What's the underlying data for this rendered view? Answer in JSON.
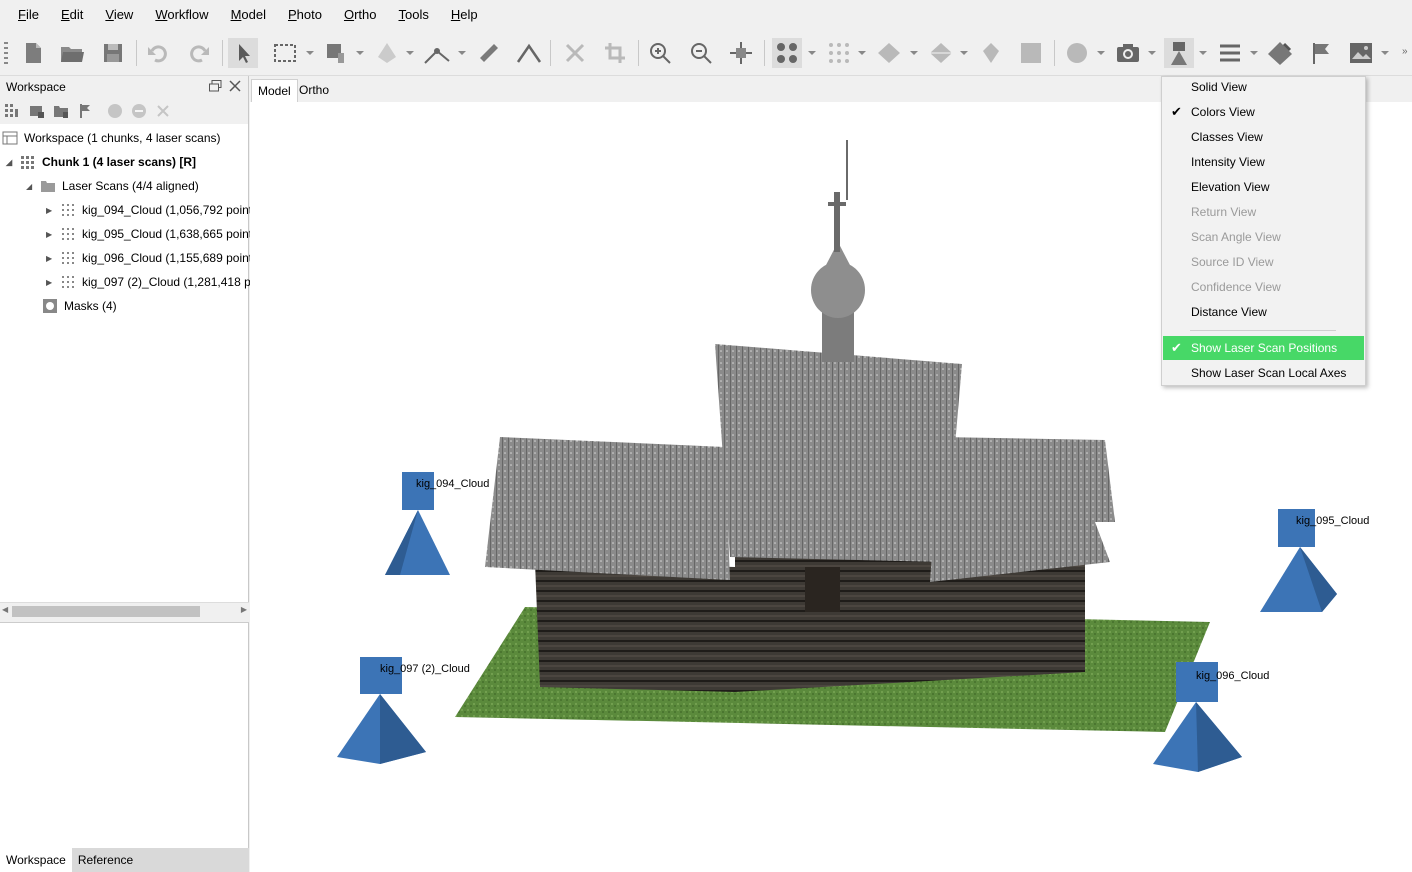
{
  "menubar": {
    "items": [
      {
        "underline": "F",
        "rest": "ile"
      },
      {
        "underline": "E",
        "rest": "dit"
      },
      {
        "underline": "V",
        "rest": "iew"
      },
      {
        "underline": "W",
        "rest": "orkflow"
      },
      {
        "underline": "M",
        "rest": "odel"
      },
      {
        "underline": "P",
        "rest": "hoto"
      },
      {
        "underline": "O",
        "rest": "rtho"
      },
      {
        "underline": "T",
        "rest": "ools"
      },
      {
        "underline": "H",
        "rest": "elp"
      }
    ]
  },
  "workspace_panel": {
    "title": "Workspace",
    "tree": {
      "root": "Workspace (1 chunks, 4 laser scans)",
      "chunk": "Chunk 1 (4 laser scans) [R]",
      "laser_scans_folder": "Laser Scans (4/4 aligned)",
      "scans": [
        "kig_094_Cloud (1,056,792 point",
        "kig_095_Cloud (1,638,665 point",
        "kig_096_Cloud (1,155,689 point",
        "kig_097 (2)_Cloud (1,281,418 pc"
      ],
      "masks": "Masks (4)"
    },
    "bottom_tabs": [
      "Workspace",
      "Reference"
    ]
  },
  "view_tabs": [
    "Model",
    "Ortho"
  ],
  "dropdown": {
    "items": [
      {
        "label": "Solid View",
        "state": "normal"
      },
      {
        "label": "Colors View",
        "state": "checked"
      },
      {
        "label": "Classes View",
        "state": "normal"
      },
      {
        "label": "Intensity View",
        "state": "normal"
      },
      {
        "label": "Elevation View",
        "state": "normal"
      },
      {
        "label": "Return View",
        "state": "disabled"
      },
      {
        "label": "Scan Angle View",
        "state": "disabled"
      },
      {
        "label": "Source ID View",
        "state": "disabled"
      },
      {
        "label": "Confidence View",
        "state": "disabled"
      },
      {
        "label": "Distance View",
        "state": "normal"
      },
      {
        "label": "Show Laser Scan Positions",
        "state": "highlighted-checked"
      },
      {
        "label": "Show Laser Scan Local Axes",
        "state": "normal"
      }
    ]
  },
  "viewport": {
    "scan_labels": [
      "kig_094_Cloud",
      "kig_095_Cloud",
      "kig_096_Cloud",
      "kig_097 (2)_Cloud"
    ],
    "scan_marker_color": "#3c74b6",
    "highlight_color": "#47d867"
  },
  "toolbar": {
    "icons": [
      "new-document-icon",
      "open-folder-icon",
      "save-icon",
      "undo-icon",
      "redo-icon",
      "select-arrow-icon",
      "rectangle-select-icon",
      "brush-select-icon",
      "shape-icon",
      "marker-icon",
      "ruler-icon",
      "measure-icon",
      "delete-icon",
      "crop-icon",
      "zoom-in-icon",
      "zoom-out-icon",
      "move-icon",
      "points-view-icon",
      "dense-points-icon",
      "mesh-icon",
      "textured-mesh-icon",
      "tiled-model-icon",
      "dem-icon",
      "globe-icon",
      "camera-icon",
      "laser-scanner-icon",
      "menu-lines-icon",
      "diamond-icon",
      "flag-icon",
      "image-icon"
    ]
  }
}
